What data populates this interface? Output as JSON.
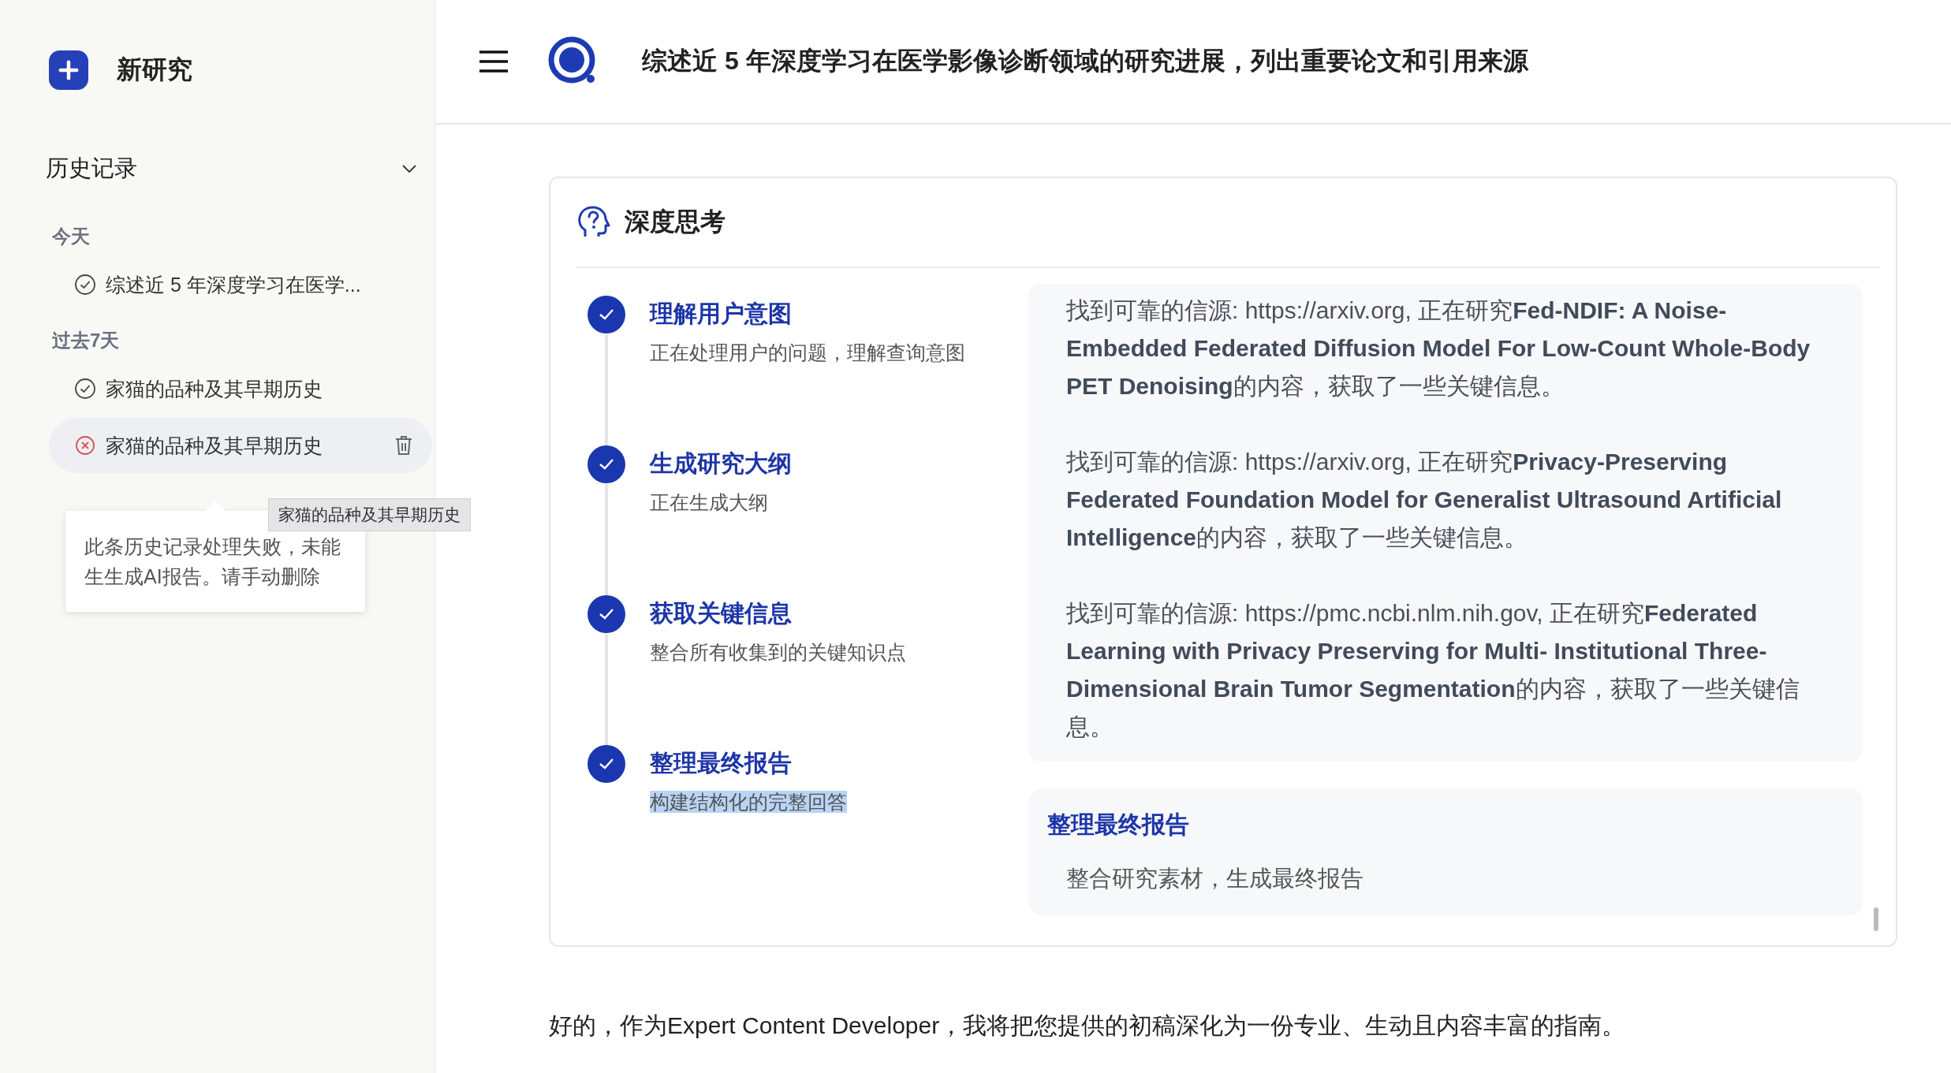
{
  "sidebar": {
    "new_button": {
      "label": "新研究"
    },
    "history_title": "历史记录",
    "expanded": true,
    "groups": [
      {
        "label": "今天",
        "items": [
          {
            "title": "综述近 5 年深度学习在医学...",
            "kind": "done",
            "selected": false
          }
        ]
      },
      {
        "label": "过去7天",
        "items": [
          {
            "title": "家猫的品种及其早期历史",
            "kind": "done",
            "selected": false
          },
          {
            "title": "家猫的品种及其早期历史",
            "kind": "failed",
            "selected": true
          }
        ]
      }
    ],
    "tooltip": "家猫的品种及其早期历史",
    "popover": "此条历史记录处理失败，未能生生成AI报告。请手动删除"
  },
  "header": {
    "title": "综述近 5 年深度学习在医学影像诊断领域的研究进展，列出重要论文和引用来源"
  },
  "thinking": {
    "title": "深度思考",
    "steps": [
      {
        "title": "理解用户意图",
        "description": "正在处理用户的问题，理解查询意图",
        "completed": true,
        "text_selected": false
      },
      {
        "title": "生成研究大纲",
        "description": "正在生成大纲",
        "completed": true,
        "text_selected": false
      },
      {
        "title": "获取关键信息",
        "description": "整合所有收集到的关键知识点",
        "completed": true,
        "text_selected": false
      },
      {
        "title": "整理最终报告",
        "description": "构建结构化的完整回答",
        "completed": true,
        "text_selected": true
      }
    ],
    "sources": [
      "找到可靠的信源: https://arxiv.org, 正在研究**Fed-NDIF: A Noise-Embedded Federated Diffusion Model For Low-Count Whole-Body PET Denoising**的内容，获取了一些关键信息。",
      "找到可靠的信源: https://arxiv.org, 正在研究**Privacy-Preserving Federated Foundation Model for Generalist Ultrasound Artificial Intelligence**的内容，获取了一些关键信息。",
      "找到可靠的信源: https://pmc.ncbi.nlm.nih.gov, 正在研究**Federated Learning with Privacy Preserving for Multi- Institutional Three-Dimensional Brain Tumor Segmentation**的内容，获取了一些关键信息。"
    ],
    "final": {
      "title": "整理最终报告",
      "text": "整合研究素材，生成最终报告"
    }
  },
  "answer": "好的，作为Expert Content Developer，我将把您提供的初稿深化为一份专业、生动且内容丰富的指南。"
}
